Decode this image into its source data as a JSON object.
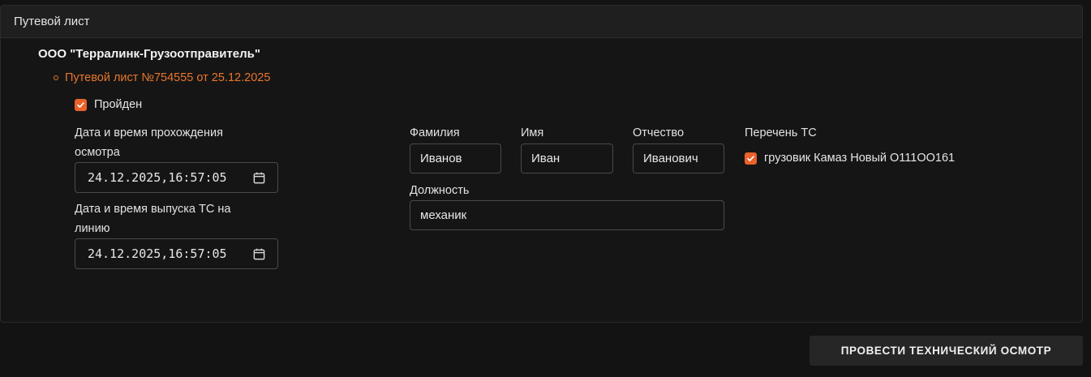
{
  "panel": {
    "title": "Путевой лист"
  },
  "organization": {
    "name": "ООО \"Терралинк-Грузоотправитель\""
  },
  "waybill": {
    "link_text": "Путевой лист №754555 от 25.12.2025"
  },
  "passed_checkbox": {
    "label": "Пройден",
    "checked": true
  },
  "inspection_datetime": {
    "label_line1": "Дата и время прохождения",
    "label_line2": "осмотра",
    "value": "24.12.2025,16:57:05"
  },
  "release_datetime": {
    "label_line1": "Дата и время выпуска ТС на",
    "label_line2": "линию",
    "value": "24.12.2025,16:57:05"
  },
  "person": {
    "surname_label": "Фамилия",
    "surname_value": "Иванов",
    "name_label": "Имя",
    "name_value": "Иван",
    "patronymic_label": "Отчество",
    "patronymic_value": "Иванович",
    "position_label": "Должность",
    "position_value": "механик"
  },
  "vehicles": {
    "label": "Перечень ТС",
    "items": [
      {
        "label": "грузовик Камаз Новый О111ОО161",
        "checked": true
      }
    ]
  },
  "action": {
    "label": "ПРОВЕСТИ ТЕХНИЧЕСКИЙ ОСМОТР"
  },
  "colors": {
    "accent": "#e9762b",
    "checkbox": "#e9622b",
    "background": "#151515"
  },
  "icons": {
    "calendar": "calendar-icon",
    "check": "checkmark-icon"
  }
}
